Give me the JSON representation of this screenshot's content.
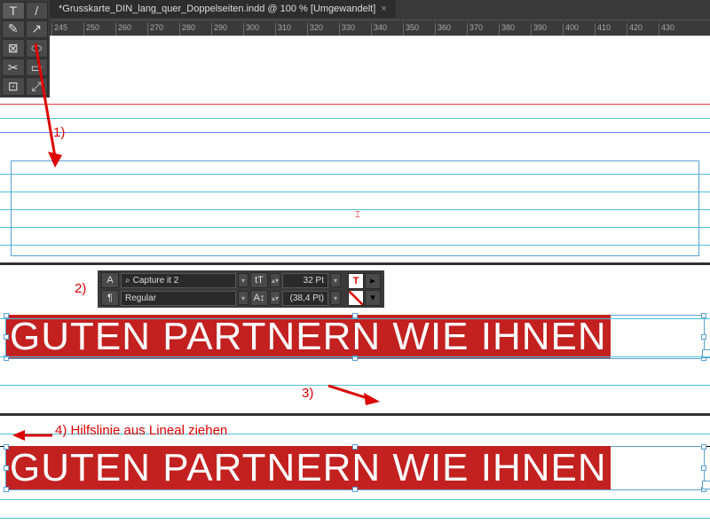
{
  "tab": {
    "title": "*Grusskarte_DIN_lang_quer_Doppelseiten.indd @ 100 % [Umgewandelt]"
  },
  "ruler": {
    "marks": [
      "245",
      "250",
      "260",
      "270",
      "280",
      "290",
      "300",
      "310",
      "320",
      "330",
      "340",
      "350",
      "360",
      "370",
      "380",
      "390",
      "400",
      "410",
      "420",
      "430"
    ]
  },
  "toolbox": {
    "tools": [
      "T",
      "/",
      "✎",
      "↗",
      "⊠",
      "⬭",
      "✂",
      "▭",
      "⊡",
      "⤢"
    ]
  },
  "callouts": {
    "c1": "1)",
    "c2": "2)",
    "c3": "3)",
    "c4": "4) Hilfslinie aus Lineal ziehen"
  },
  "ctrl": {
    "font_name": "Capture it 2",
    "font_style": "Regular",
    "size_label": "32 Pt",
    "leading_label": "(38,4 Pt)",
    "search_icon": "⌕",
    "tt_icon": "tT",
    "la_icon": "A↕"
  },
  "text": {
    "line": "GUTEN PARTNERN WIE IHNEN"
  }
}
